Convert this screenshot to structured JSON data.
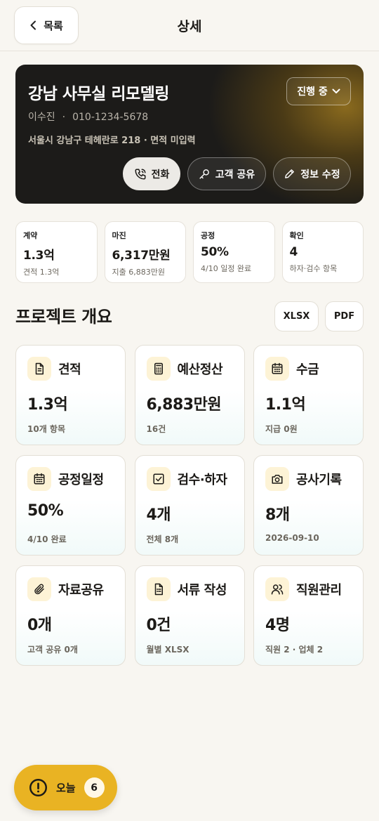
{
  "header": {
    "back_label": "목록",
    "title": "상세"
  },
  "project": {
    "name": "강남 사무실 리모델링",
    "client": "이수진",
    "separator": "·",
    "phone": "010-1234-5678",
    "address": "서울시 강남구 테헤란로 218 · 면적 미입력",
    "status": "진행 중",
    "actions": {
      "call": "전화",
      "share": "고객 공유",
      "edit": "정보 수정"
    }
  },
  "stats": [
    {
      "label": "계약",
      "value": "1.3억",
      "sub": "견적 1.3억"
    },
    {
      "label": "마진",
      "value": "6,317만원",
      "sub": "지출 6,883만원"
    },
    {
      "label": "공정",
      "value": "50%",
      "sub": "4/10 일정 완료"
    },
    {
      "label": "확인",
      "value": "4",
      "sub": "하자·검수 항목"
    }
  ],
  "overview": {
    "title": "프로젝트 개요",
    "export_xlsx": "XLSX",
    "export_pdf": "PDF"
  },
  "cards": [
    {
      "title": "견적",
      "value": "1.3억",
      "sub": "10개 항목",
      "icon": "document-icon"
    },
    {
      "title": "예산정산",
      "value": "6,883만원",
      "sub": "16건",
      "icon": "calculator-icon"
    },
    {
      "title": "수금",
      "value": "1.1억",
      "sub": "지급 0원",
      "icon": "calendar-icon"
    },
    {
      "title": "공정일정",
      "value": "50%",
      "sub": "4/10 완료",
      "icon": "calendar-icon"
    },
    {
      "title": "검수·하자",
      "value": "4개",
      "sub": "전체 8개",
      "icon": "checkbox-icon"
    },
    {
      "title": "공사기록",
      "value": "8개",
      "sub": "2026-09-10",
      "icon": "camera-icon"
    },
    {
      "title": "자료공유",
      "value": "0개",
      "sub": "고객 공유 0개",
      "icon": "paperclip-icon"
    },
    {
      "title": "서류 작성",
      "value": "0건",
      "sub": "월별 XLSX",
      "icon": "file-form-icon"
    },
    {
      "title": "직원관리",
      "value": "4명",
      "sub": "직원 2 · 업체 2",
      "icon": "users-icon"
    }
  ],
  "today": {
    "label": "오늘",
    "count": "6"
  }
}
